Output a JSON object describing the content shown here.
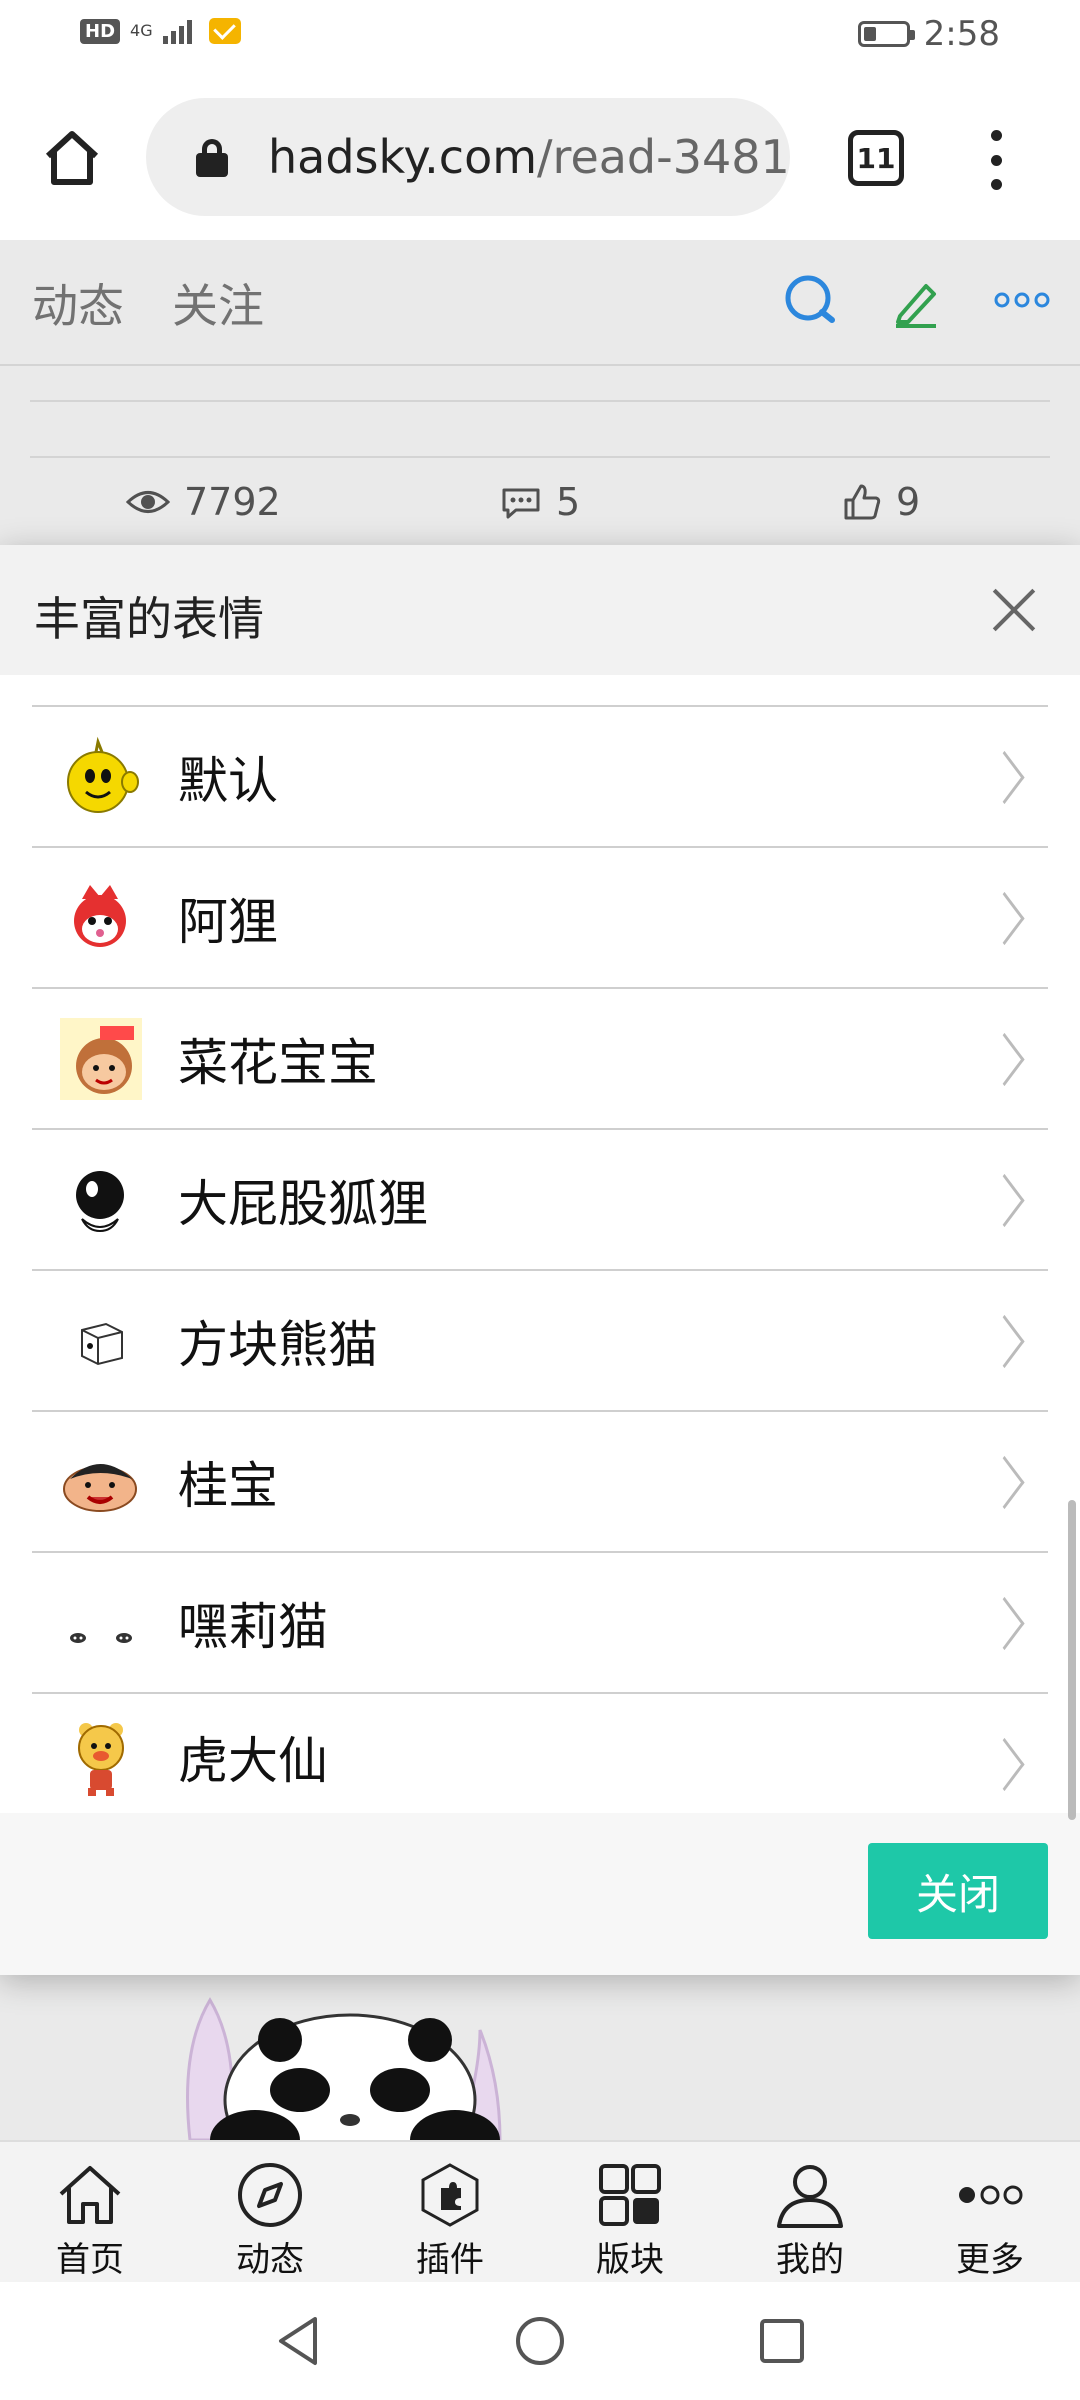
{
  "status_bar": {
    "badge": "HD",
    "network": "4G",
    "time": "2:58",
    "battery_level": 0.3
  },
  "browser": {
    "url_host": "hadsky.com",
    "url_path": "/read-3481",
    "tab_count": "11"
  },
  "page": {
    "tabs": [
      "动态",
      "关注"
    ],
    "stats": {
      "views": "7792",
      "comments": "5",
      "likes": "9"
    }
  },
  "modal": {
    "title": "丰富的表情",
    "items": [
      {
        "label": "默认",
        "icon": "default-emoji-icon"
      },
      {
        "label": "阿狸",
        "icon": "ali-fox-icon"
      },
      {
        "label": "菜花宝宝",
        "icon": "caihua-baby-icon"
      },
      {
        "label": "大屁股狐狸",
        "icon": "big-butt-fox-icon"
      },
      {
        "label": "方块熊猫",
        "icon": "cube-panda-icon"
      },
      {
        "label": "桂宝",
        "icon": "guibao-icon"
      },
      {
        "label": "嘿莉猫",
        "icon": "heili-cat-icon"
      },
      {
        "label": "虎大仙",
        "icon": "tiger-immortal-icon"
      }
    ],
    "close_button": "关闭"
  },
  "bottom_nav": [
    {
      "label": "首页",
      "icon": "home-icon"
    },
    {
      "label": "动态",
      "icon": "compass-icon"
    },
    {
      "label": "插件",
      "icon": "puzzle-icon"
    },
    {
      "label": "版块",
      "icon": "grid-icon"
    },
    {
      "label": "我的",
      "icon": "user-icon"
    },
    {
      "label": "更多",
      "icon": "more-icon"
    }
  ],
  "colors": {
    "accent": "#1ec8a8",
    "search_icon": "#2e8de6",
    "edit_icon": "#35a853",
    "more_icon": "#2e8de6"
  }
}
